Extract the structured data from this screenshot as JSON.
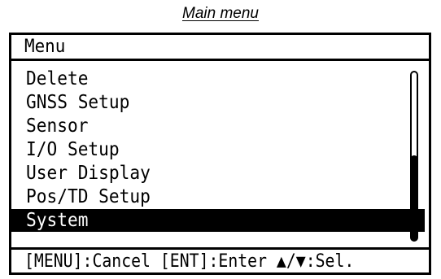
{
  "caption": "Main menu",
  "screen": {
    "title": "Menu",
    "items": [
      {
        "label": "Delete",
        "selected": false
      },
      {
        "label": "GNSS Setup",
        "selected": false
      },
      {
        "label": "Sensor",
        "selected": false
      },
      {
        "label": "I/O Setup",
        "selected": false
      },
      {
        "label": "User Display",
        "selected": false
      },
      {
        "label": "Pos/TD Setup",
        "selected": false
      },
      {
        "label": "System",
        "selected": true
      }
    ],
    "scroll_position_fraction": 0.5,
    "footer": "[MENU]:Cancel [ENT]:Enter ▲/▼:Sel."
  },
  "colors": {
    "background": "#ffffff",
    "foreground": "#000000",
    "highlight_bg": "#000000",
    "highlight_fg": "#ffffff"
  }
}
